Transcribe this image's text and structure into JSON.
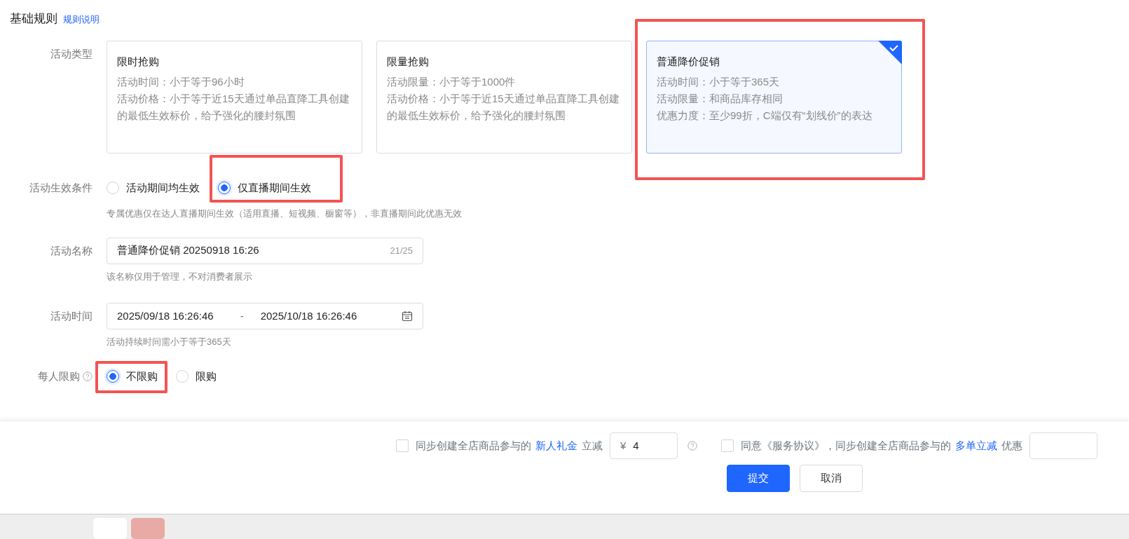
{
  "section": {
    "title": "基础规则",
    "link": "规则说明"
  },
  "activity_type": {
    "label": "活动类型",
    "cards": [
      {
        "title": "限时抢购",
        "lines": [
          "活动时间：小于等于96小时",
          "活动价格：小于等于近15天通过单品直降工具创建的最低生效标价，给予强化的腰封氛围"
        ],
        "selected": false,
        "highlighted": false
      },
      {
        "title": "限量抢购",
        "lines": [
          "活动限量：小于等于1000件",
          "活动价格：小于等于近15天通过单品直降工具创建的最低生效标价，给予强化的腰封氛围"
        ],
        "selected": false,
        "highlighted": false
      },
      {
        "title": "普通降价促销",
        "lines": [
          "活动时间：小于等于365天",
          "活动限量：和商品库存相同",
          "优惠力度：至少99折，C端仅有“划线价”的表达"
        ],
        "selected": true,
        "highlighted": true
      }
    ]
  },
  "effect_condition": {
    "label": "活动生效条件",
    "options": [
      {
        "label": "活动期间均生效",
        "selected": false,
        "highlighted": false
      },
      {
        "label": "仅直播期间生效",
        "selected": true,
        "highlighted": true
      }
    ],
    "hint": "专属优惠仅在达人直播期间生效（适用直播、短视频、橱窗等），非直播期间此优惠无效"
  },
  "activity_name": {
    "label": "活动名称",
    "value": "普通降价促销 20250918 16:26",
    "counter": "21/25",
    "hint": "该名称仅用于管理，不对消费者展示"
  },
  "activity_time": {
    "label": "活动时间",
    "start": "2025/09/18 16:26:46",
    "separator": "-",
    "end": "2025/10/18 16:26:46",
    "hint": "活动持续时间需小于等于365天"
  },
  "purchase_limit": {
    "label": "每人限购",
    "help": true,
    "options": [
      {
        "label": "不限购",
        "selected": true,
        "highlighted": true
      },
      {
        "label": "限购",
        "selected": false,
        "highlighted": false
      }
    ]
  },
  "footer": {
    "agreements": [
      {
        "checked": false,
        "text": "同步创建全店商品参与的",
        "link": "新人礼金",
        "suffix": "立减",
        "currency": "¥",
        "value": "4",
        "help": true
      },
      {
        "checked": false,
        "text": "同意《服务协议》，同步创建全店商品参与的",
        "link": "多单立减",
        "suffix": "优惠"
      }
    ],
    "buttons": [
      {
        "label": "提交",
        "kind": "primary"
      },
      {
        "label": "取消",
        "kind": "secondary"
      }
    ]
  }
}
